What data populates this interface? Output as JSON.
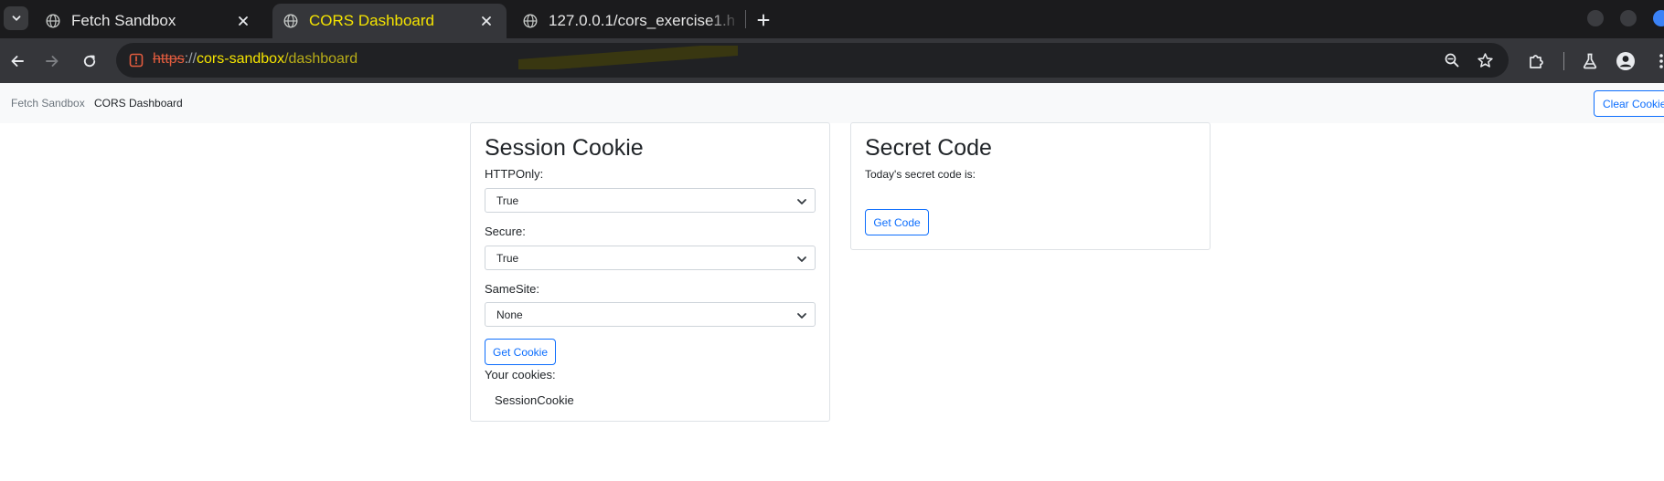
{
  "colors": {
    "accent": "#0d6efd",
    "active_tab_title": "#f5e400",
    "url_host": "#f5e400",
    "url_scheme_insecure": "#e25c3e",
    "tab_strip_bg": "#1b1b1d",
    "toolbar_bg": "#35363a"
  },
  "browser": {
    "tabs": [
      {
        "title": "Fetch Sandbox",
        "icon": "globe-icon",
        "active": false
      },
      {
        "title": "CORS Dashboard",
        "icon": "globe-icon",
        "active": true
      },
      {
        "title": "127.0.0.1/cors_exercise1.h",
        "icon": "globe-icon",
        "active": false
      }
    ],
    "url": {
      "scheme": "https",
      "separator": "://",
      "host": "cors-sandbox",
      "path": "/dashboard"
    },
    "icons": {
      "tab_search": "chevron-down-icon",
      "tab_close": "close-icon",
      "new_tab": "plus-icon",
      "back": "arrow-left-icon",
      "forward": "arrow-right-icon",
      "reload": "reload-icon",
      "site_info": "not-secure-icon",
      "zoom": "zoom-icon",
      "bookmark": "star-icon",
      "extensions": "puzzle-icon",
      "labs": "flask-icon",
      "profile": "profile-icon",
      "menu": "more-vert-icon"
    }
  },
  "page": {
    "breadcrumb": [
      "Fetch Sandbox",
      "CORS Dashboard"
    ],
    "clear_cookies_label": "Clear Cookies",
    "session_card": {
      "title": "Session Cookie",
      "httponly_label": "HTTPOnly:",
      "httponly_value": "True",
      "secure_label": "Secure:",
      "secure_value": "True",
      "samesite_label": "SameSite:",
      "samesite_value": "None",
      "get_cookie_label": "Get Cookie",
      "your_cookies_label": "Your cookies:",
      "cookies": [
        "SessionCookie"
      ]
    },
    "secret_card": {
      "title": "Secret Code",
      "text": "Today's secret code is:",
      "get_code_label": "Get Code"
    }
  }
}
